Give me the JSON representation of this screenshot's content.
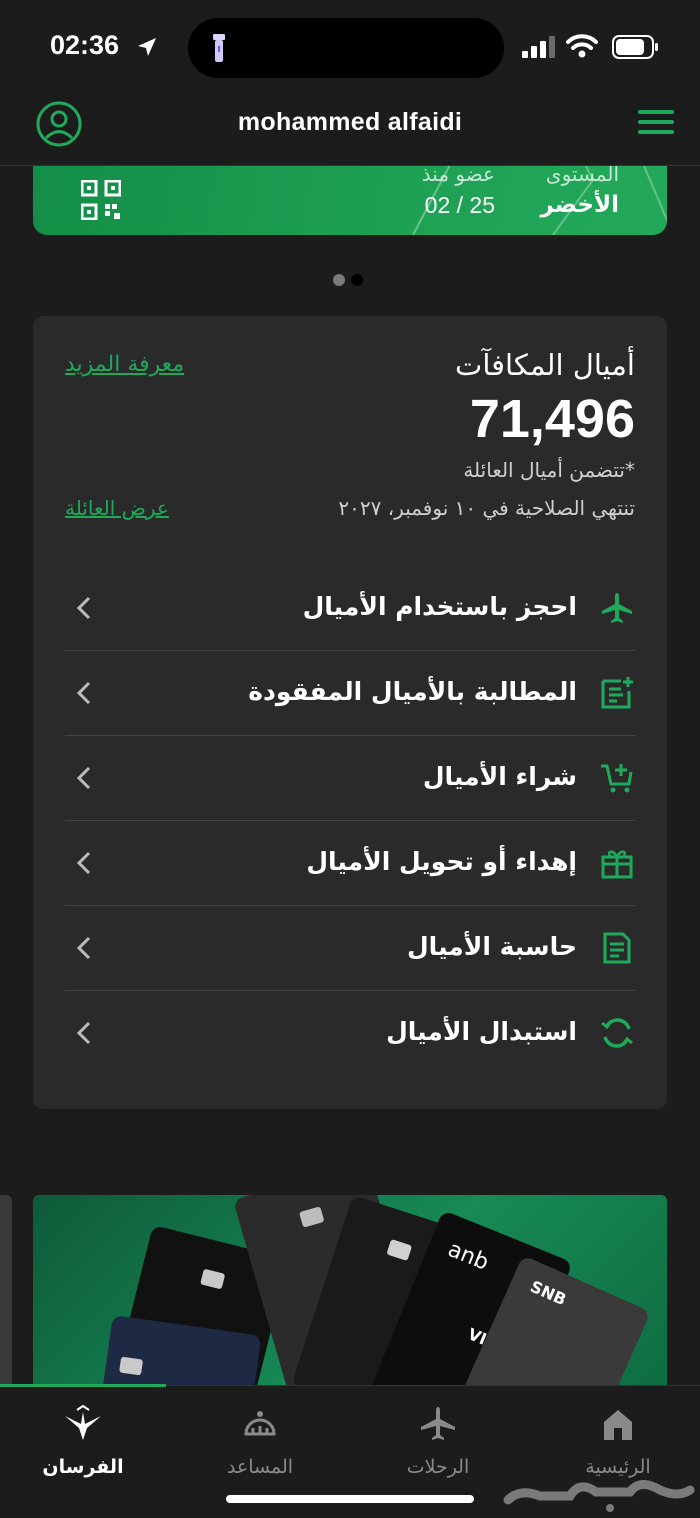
{
  "status_bar": {
    "time": "02:36"
  },
  "header": {
    "title": "mohammed alfaidi"
  },
  "card": {
    "level_label": "المستوى",
    "level_value": "الأخضر",
    "since_label": "عضو منذ",
    "since_value": "02 / 25"
  },
  "carousel": {
    "total": 2,
    "active_index": 1
  },
  "rewards": {
    "title": "أميال المكافآت",
    "learn_more": "معرفة المزيد",
    "miles": "71,496",
    "family_note": "تتضمن أميال العائلة*",
    "expiry": "تنتهي الصلاحية في ١٠ نوفمبر، ٢٠٢٧",
    "view_family": "عرض العائلة"
  },
  "menu": [
    {
      "label": "احجز باستخدام الأميال",
      "icon": "plane-icon"
    },
    {
      "label": "المطالبة بالأميال المفقودة",
      "icon": "claim-document-icon"
    },
    {
      "label": "شراء الأميال",
      "icon": "cart-add-icon"
    },
    {
      "label": "إهداء أو تحويل الأميال",
      "icon": "gift-icon"
    },
    {
      "label": "حاسبة الأميال",
      "icon": "calculator-document-icon"
    },
    {
      "label": "استبدال الأميال",
      "icon": "refresh-icon"
    }
  ],
  "tabs": [
    {
      "label": "الرئيسية",
      "icon": "home-icon",
      "active": false
    },
    {
      "label": "الرحلات",
      "icon": "plane-icon",
      "active": false
    },
    {
      "label": "المساعد",
      "icon": "assistant-icon",
      "active": false
    },
    {
      "label": "الفرسان",
      "icon": "alfursan-logo-icon",
      "active": true
    }
  ],
  "colors": {
    "accent": "#1faa5b",
    "background": "#1c1c1c",
    "panel": "#2a2a2a"
  }
}
